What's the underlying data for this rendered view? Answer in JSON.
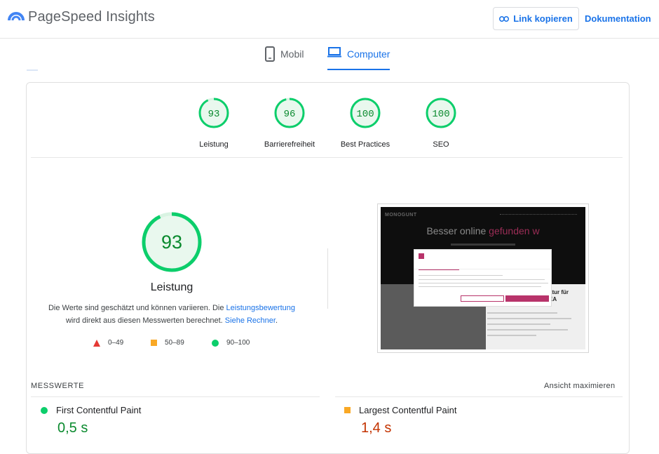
{
  "header": {
    "brand": "PageSpeed Insights",
    "copy_link": "Link kopieren",
    "docs": "Dokumentation"
  },
  "tabs": [
    {
      "label": "Mobil",
      "icon": "smartphone-icon",
      "selected": false
    },
    {
      "label": "Computer",
      "icon": "laptop-icon",
      "selected": true
    }
  ],
  "categories": [
    {
      "score": "93",
      "label": "Leistung"
    },
    {
      "score": "96",
      "label": "Barrierefreiheit"
    },
    {
      "score": "100",
      "label": "Best Practices"
    },
    {
      "score": "100",
      "label": "SEO"
    }
  ],
  "performance": {
    "score": "93",
    "score_fraction": 0.93,
    "title": "Leistung",
    "desc_part1": "Die Werte sind geschätzt und können variieren. Die ",
    "desc_link1": "Leistungsbewertung",
    "desc_part2": "wird direkt aus diesen Messwerten berechnet. ",
    "desc_link2": "Siehe Rechner",
    "desc_end": "."
  },
  "legend": [
    {
      "shape": "triangle",
      "range": "0–49",
      "color": "#e53935"
    },
    {
      "shape": "square",
      "range": "50–89",
      "color": "#f9a825"
    },
    {
      "shape": "circle",
      "range": "90–100",
      "color": "#0cce6b"
    }
  ],
  "screenshot": {
    "site_logo": "MONOGUNT",
    "headline_a": "Besser online ",
    "headline_b": "gefunden w",
    "side_title_1": "ktur für",
    "side_title_2": "EA"
  },
  "metrics": {
    "section_title": "MESSWERTE",
    "expand": "Ansicht maximieren",
    "items": [
      {
        "name": "First Contentful Paint",
        "value": "0,5 s",
        "status": "good",
        "color": "#0a8a2e"
      },
      {
        "name": "Largest Contentful Paint",
        "value": "1,4 s",
        "status": "average",
        "color": "#c33300"
      }
    ]
  },
  "colors": {
    "accent": "#1a73e8",
    "good": "#0cce6b",
    "good_text": "#0a8a2e",
    "average": "#f9a825",
    "poor": "#e53935"
  }
}
